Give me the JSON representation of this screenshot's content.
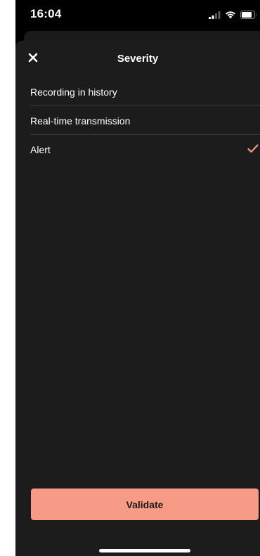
{
  "status_bar": {
    "time": "16:04",
    "icons": [
      "signal-icon",
      "wifi-icon",
      "battery-icon"
    ]
  },
  "sheet": {
    "title": "Severity",
    "close_icon": "close-icon",
    "options": [
      {
        "label": "Recording in history",
        "selected": false
      },
      {
        "label": "Real-time transmission",
        "selected": false
      },
      {
        "label": "Alert",
        "selected": true
      }
    ],
    "validate_label": "Validate"
  },
  "colors": {
    "background": "#000000",
    "sheet": "#1c1c1c",
    "accent": "#f79a86",
    "divider": "#3a3a3a",
    "text": "#ffffff"
  }
}
